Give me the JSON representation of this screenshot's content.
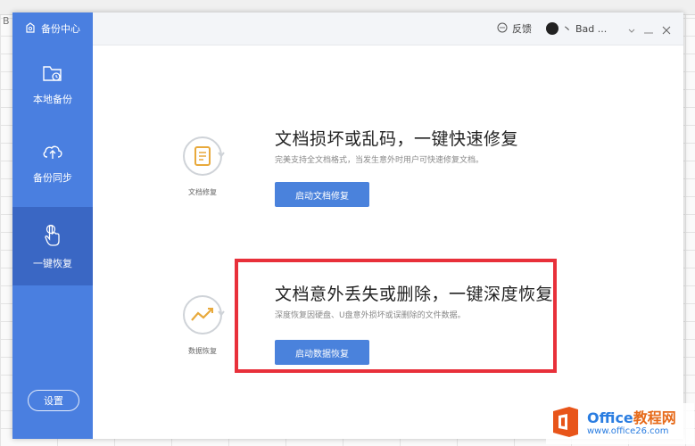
{
  "background": {
    "column_label": "B"
  },
  "sidebar": {
    "app_title": "备份中心",
    "items": [
      {
        "label": "本地备份",
        "icon": "folder-clock-icon"
      },
      {
        "label": "备份同步",
        "icon": "cloud-upload-icon"
      },
      {
        "label": "一键恢复",
        "icon": "touch-hand-icon"
      }
    ],
    "active_index": 2,
    "settings_label": "设置"
  },
  "titlebar": {
    "feedback_label": "反馈",
    "user_name": "Bad ...",
    "separator": "丶"
  },
  "features": [
    {
      "icon_label": "文档修复",
      "title": "文档损坏或乱码，一键快速修复",
      "description": "完美支持全文档格式，当发生意外时用户可快速修复文档。",
      "button_label": "启动文档修复"
    },
    {
      "icon_label": "数据恢复",
      "title": "文档意外丢失或删除，一键深度恢复",
      "description": "深度恢复因硬盘、U盘意外损坏或误删除的文件数据。",
      "button_label": "启动数据恢复"
    }
  ],
  "watermark": {
    "brand": "Office",
    "brand_suffix": "教程网",
    "url": "www.office26.com"
  },
  "colors": {
    "sidebar": "#4a7fe0",
    "sidebar_active": "#3a67c4",
    "button": "#4a82dc",
    "highlight": "#e8303a",
    "icon_accent": "#e8a93b"
  }
}
